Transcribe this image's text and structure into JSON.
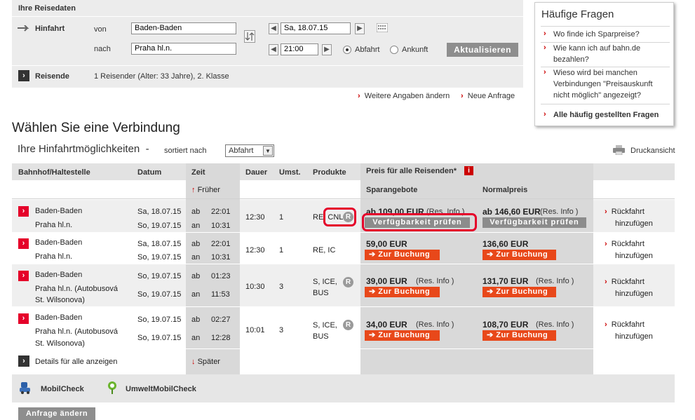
{
  "search": {
    "heading": "Ihre Reisedaten",
    "outbound_label": "Hinfahrt",
    "from_label": "von",
    "from_value": "Baden-Baden",
    "to_label": "nach",
    "to_value": "Praha hl.n.",
    "date_value": "Sa, 18.07.15",
    "time_value": "21:00",
    "departure_label": "Abfahrt",
    "arrival_label": "Ankunft",
    "update_button": "Aktualisieren",
    "travellers_label": "Reisende",
    "travellers_value": "1 Reisender (Alter: 33 Jahre), 2. Klasse",
    "more_details_link": "Weitere Angaben ändern",
    "new_request_link": "Neue Anfrage"
  },
  "faq": {
    "title": "Häufige Fragen",
    "questions": [
      "Wo finde ich Sparpreise?",
      "Wie kann ich auf bahn.de bezahlen?",
      "Wieso wird bei manchen Verbindungen \"Preisauskunft nicht möglich\" angezeigt?"
    ],
    "all_link": "Alle häufig gestellten Fragen"
  },
  "results": {
    "title": "Wählen Sie eine Verbindung",
    "subtitle": "Ihre Hinfahrtmöglichkeiten",
    "dash": "-",
    "sorted_by_label": "sortiert nach",
    "sort_value": "Abfahrt",
    "print_label": "Druckansicht"
  },
  "table": {
    "headers": {
      "station": "Bahnhof/Haltestelle",
      "date": "Datum",
      "time": "Zeit",
      "duration": "Dauer",
      "changes": "Umst.",
      "products": "Produkte",
      "price": "Preis für alle Reisenden*",
      "saver": "Sparangebote",
      "normal": "Normalpreis"
    },
    "earlier": "Früher",
    "later": "Später",
    "dep_abbr": "ab",
    "arr_abbr": "an",
    "res_info": "(Res. Info )",
    "book_label": "Zur Buchung",
    "check_label": "Verfügbarkeit prüfen",
    "return_line1": "Rückfahrt",
    "return_line2": "hinzufügen",
    "show_all_details": "Details für alle anzeigen",
    "r_badge": "R",
    "rows": [
      {
        "from": "Baden-Baden",
        "to": "Praha hl.n.",
        "to2": "",
        "dep_date": "Sa, 18.07.15",
        "arr_date": "So, 19.07.15",
        "dep_time": "22:01",
        "arr_time": "10:31",
        "duration": "12:30",
        "changes": "1",
        "products1": "RE, CNL",
        "products2": "",
        "saver_price": "ab 109,00 EUR",
        "normal_price": "ab 146,60 EUR"
      },
      {
        "from": "Baden-Baden",
        "to": "Praha hl.n.",
        "to2": "",
        "dep_date": "Sa, 18.07.15",
        "arr_date": "So, 19.07.15",
        "dep_time": "22:01",
        "arr_time": "10:31",
        "duration": "12:30",
        "changes": "1",
        "products1": "RE, IC",
        "products2": "",
        "saver_price": "59,00 EUR",
        "normal_price": "136,60 EUR"
      },
      {
        "from": "Baden-Baden",
        "to": "Praha hl.n. (Autobusová",
        "to2": "St. Wilsonova)",
        "dep_date": "So, 19.07.15",
        "arr_date": "So, 19.07.15",
        "dep_time": "01:23",
        "arr_time": "11:53",
        "duration": "10:30",
        "changes": "3",
        "products1": "S, ICE,",
        "products2": "BUS",
        "saver_price": "39,00 EUR",
        "normal_price": "131,70 EUR"
      },
      {
        "from": "Baden-Baden",
        "to": "Praha hl.n. (Autobusová",
        "to2": "St. Wilsonova)",
        "dep_date": "So, 19.07.15",
        "arr_date": "So, 19.07.15",
        "dep_time": "02:27",
        "arr_time": "12:28",
        "duration": "10:01",
        "changes": "3",
        "products1": "S, ICE,",
        "products2": "BUS",
        "saver_price": "34,00 EUR",
        "normal_price": "108,70 EUR"
      }
    ]
  },
  "bottom": {
    "mobilcheck": "MobilCheck",
    "umwelt": "UmweltMobilCheck",
    "change_request": "Anfrage ändern"
  },
  "colors": {
    "accent_red": "#e5002a",
    "book_orange": "#e8481a",
    "panel_gray": "#ececec"
  }
}
